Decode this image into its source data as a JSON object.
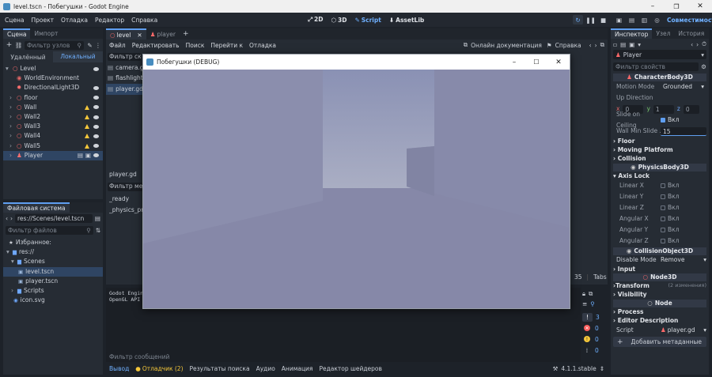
{
  "window": {
    "title": "level.tscn - Побегушки - Godot Engine"
  },
  "menu": {
    "items": [
      "Сцена",
      "Проект",
      "Отладка",
      "Редактор",
      "Справка"
    ]
  },
  "workspaces": {
    "items": [
      "2D",
      "3D",
      "Script",
      "AssetLib"
    ],
    "active": "Script"
  },
  "renderer": {
    "label": "Совместимость"
  },
  "scene_dock": {
    "tabs": [
      "Сцена",
      "Импорт"
    ],
    "filter_placeholder": "Фильтр узлов",
    "remote_label": "Удалённый",
    "local_label": "Локальный",
    "nodes": [
      {
        "label": "Level",
        "depth": 0,
        "icon": "node3d",
        "warn": false,
        "eye": true
      },
      {
        "label": "WorldEnvironment",
        "depth": 1,
        "icon": "world",
        "warn": false,
        "eye": false
      },
      {
        "label": "DirectionalLight3D",
        "depth": 1,
        "icon": "light",
        "warn": false,
        "eye": true
      },
      {
        "label": "floor",
        "depth": 1,
        "icon": "node3d",
        "warn": false,
        "eye": true
      },
      {
        "label": "Wall",
        "depth": 1,
        "icon": "node3d",
        "warn": true,
        "eye": true
      },
      {
        "label": "Wall2",
        "depth": 1,
        "icon": "node3d",
        "warn": true,
        "eye": true
      },
      {
        "label": "Wall3",
        "depth": 1,
        "icon": "node3d",
        "warn": true,
        "eye": true
      },
      {
        "label": "Wall4",
        "depth": 1,
        "icon": "node3d",
        "warn": true,
        "eye": true
      },
      {
        "label": "Wall5",
        "depth": 1,
        "icon": "node3d",
        "warn": true,
        "eye": true
      },
      {
        "label": "Player",
        "depth": 1,
        "icon": "body",
        "warn": false,
        "eye": true,
        "selected": true
      }
    ]
  },
  "filesystem": {
    "title": "Файловая система",
    "path": "res://Scenes/level.tscn",
    "filter_placeholder": "Фильтр файлов",
    "items": [
      {
        "label": "Избранное:",
        "depth": 0,
        "icon": "star"
      },
      {
        "label": "res://",
        "depth": 0,
        "icon": "folder"
      },
      {
        "label": "Scenes",
        "depth": 1,
        "icon": "folder"
      },
      {
        "label": "level.tscn",
        "depth": 2,
        "icon": "scene",
        "selected": true
      },
      {
        "label": "player.tscn",
        "depth": 2,
        "icon": "scene"
      },
      {
        "label": "Scripts",
        "depth": 1,
        "icon": "folder"
      },
      {
        "label": "icon.svg",
        "depth": 1,
        "icon": "image"
      }
    ]
  },
  "script_editor": {
    "tabs": [
      "level",
      "player"
    ],
    "menu": [
      "Файл",
      "Редактировать",
      "Поиск",
      "Перейти к",
      "Отладка"
    ],
    "docs_label": "Онлайн документация",
    "help_label": "Справка",
    "script_filter": "Фильтр скриптов",
    "scripts": [
      "camera.gd",
      "flashlight.gd",
      "player.gd"
    ],
    "current_script": "player.gd",
    "method_filter": "Фильтр методов",
    "methods": [
      "_ready",
      "_physics_process"
    ],
    "line_col": "35",
    "tabs_label": "Tabs"
  },
  "output": {
    "lines": [
      "Godot Engine",
      "OpenGL API"
    ],
    "filter_placeholder": "Фильтр сообщений",
    "counts": [
      "3",
      "0",
      "0",
      "0"
    ]
  },
  "bottom_tabs": {
    "items": [
      "Вывод",
      "Отладчик (2)",
      "Результаты поиска",
      "Аудио",
      "Анимация",
      "Редактор шейдеров"
    ],
    "version": "4.1.1.stable"
  },
  "inspector": {
    "tabs": [
      "Инспектор",
      "Узел",
      "История"
    ],
    "node_name": "Player",
    "filter_placeholder": "Фильтр свойств",
    "class1": "CharacterBody3D",
    "motion_mode_label": "Motion Mode",
    "motion_mode_value": "Grounded",
    "up_direction_label": "Up Direction",
    "up_x": "0",
    "up_y": "1",
    "up_z": "0",
    "slide_label": "Slide on Ceiling",
    "slide_value": "Вкл",
    "wall_min_label": "Wall Min Slide ...",
    "wall_min_value": "15",
    "sections1": [
      "Floor",
      "Moving Platform",
      "Collision"
    ],
    "class2": "PhysicsBody3D",
    "axis_lock_label": "Axis Lock",
    "axis_locks": [
      "Linear X",
      "Linear Y",
      "Linear Z",
      "Angular X",
      "Angular Y",
      "Angular Z"
    ],
    "axis_lock_value": "Вкл",
    "class3": "CollisionObject3D",
    "disable_mode_label": "Disable Mode",
    "disable_mode_value": "Remove",
    "input_label": "Input",
    "class4": "Node3D",
    "transform_label": "Transform",
    "transform_changes": "(2 изменения)",
    "visibility_label": "Visibility",
    "class5": "Node",
    "process_label": "Process",
    "editor_desc_label": "Editor Description",
    "script_label": "Script",
    "script_value": "player.gd",
    "add_meta_label": "Добавить метаданные"
  },
  "game_window": {
    "title": "Побегушки (DEBUG)"
  }
}
